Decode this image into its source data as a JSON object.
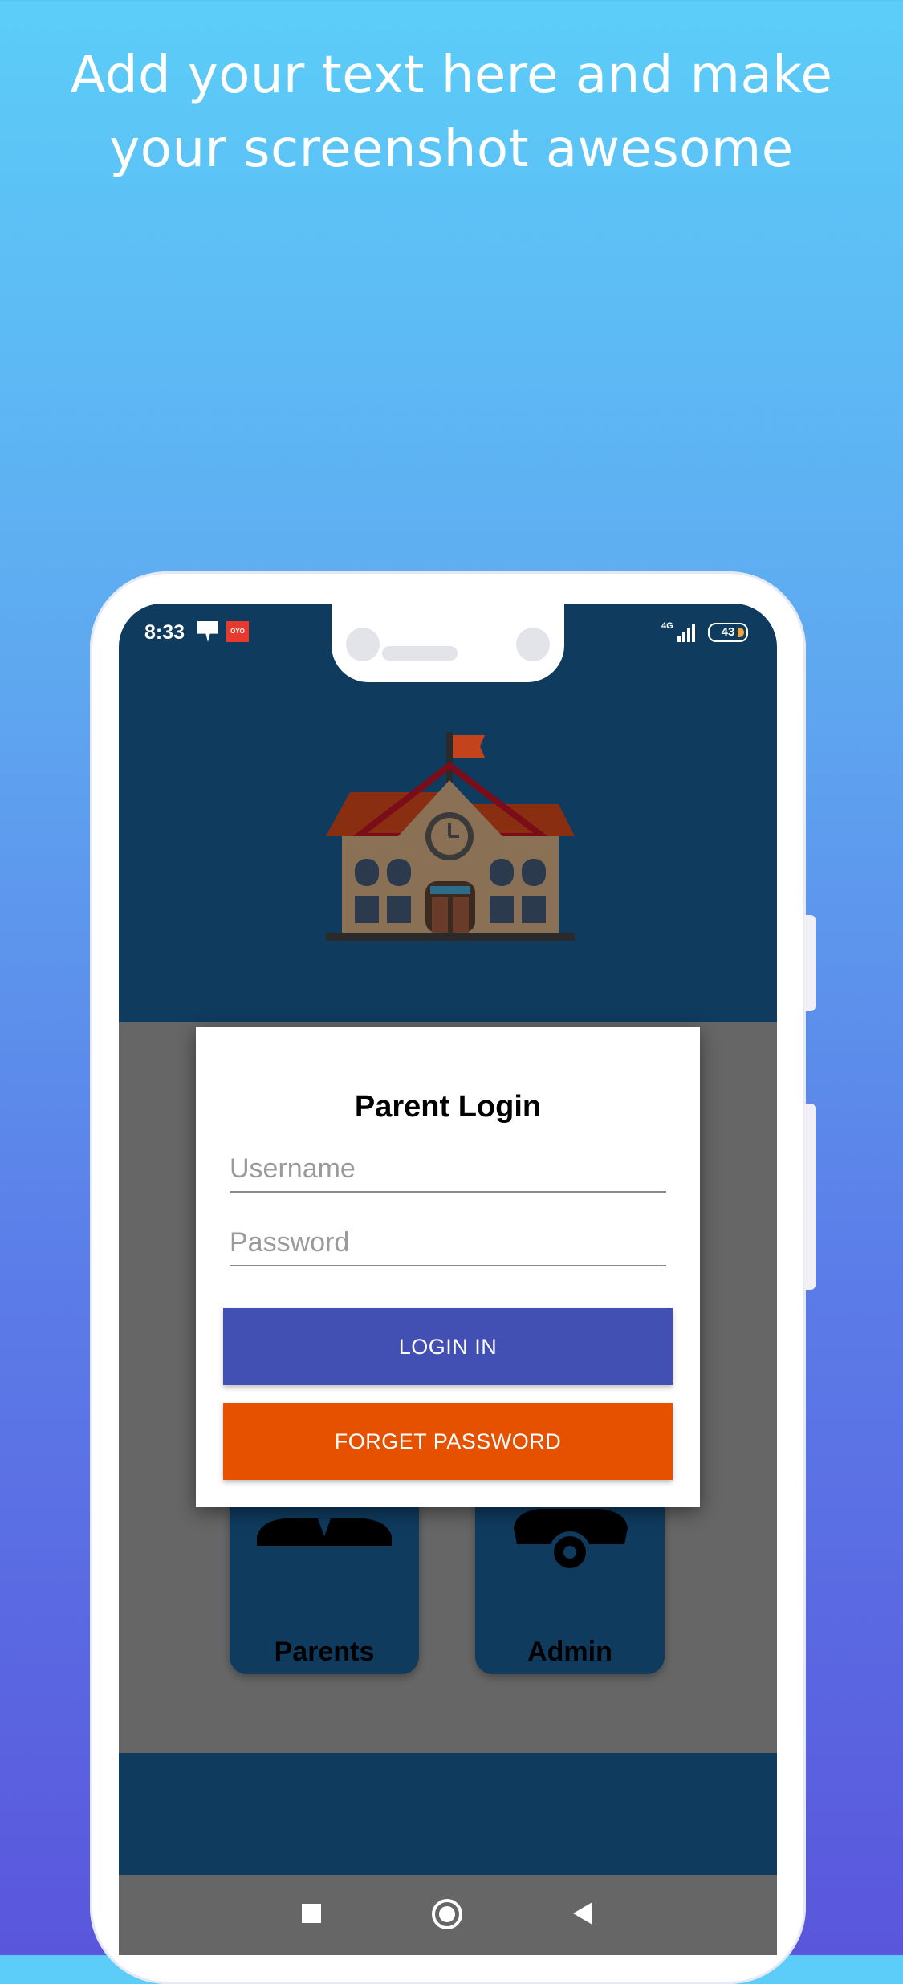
{
  "headline": {
    "line1": "Add your text here and make",
    "line2": "your screenshot awesome"
  },
  "status_bar": {
    "time": "8:33",
    "oyo_badge": "OYO",
    "network": "4G",
    "battery": "43"
  },
  "tiles": {
    "parents_label": "Parents",
    "admin_label": "Admin"
  },
  "dialog": {
    "title": "Parent Login",
    "username_placeholder": "Username",
    "password_placeholder": "Password",
    "login_label": "LOGIN IN",
    "forget_label": "FORGET PASSWORD"
  },
  "colors": {
    "primary_dark": "#0f3b5f",
    "login_button": "#4350b3",
    "forget_button": "#e65100",
    "scrim": "#666666"
  },
  "icons": [
    "school-building-icon",
    "parents-icon",
    "admin-gear-icon",
    "square-nav-icon",
    "home-circle-nav-icon",
    "back-triangle-nav-icon"
  ]
}
